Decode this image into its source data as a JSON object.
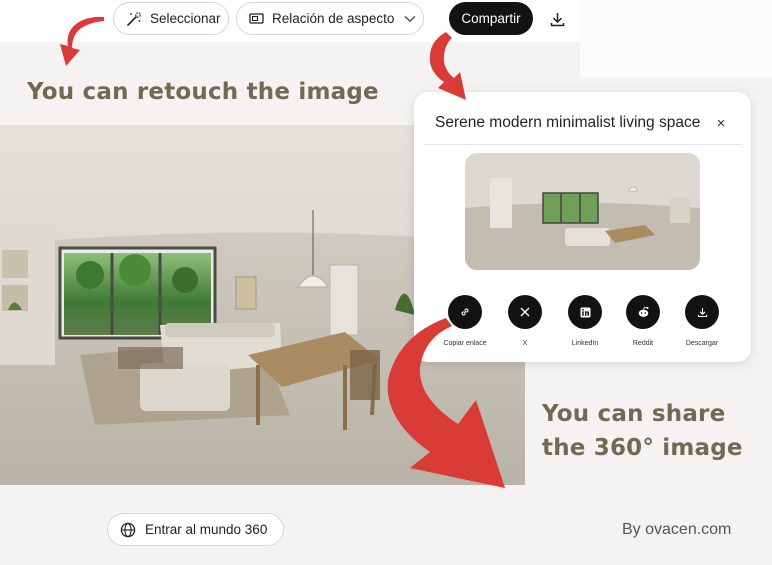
{
  "toolbar": {
    "select_label": "Seleccionar",
    "aspect_label": "Relación de aspecto",
    "share_label": "Compartir"
  },
  "captions": {
    "retouch": "You can retouch the image",
    "share_line1": "You can share",
    "share_line2": "the 360° image",
    "credit": "By ovacen.com"
  },
  "modal": {
    "title": "Serene modern minimalist living space",
    "close": "×",
    "share_options": [
      {
        "label": "Copiar enlace",
        "icon": "link-icon"
      },
      {
        "label": "X",
        "icon": "x-icon"
      },
      {
        "label": "LinkedIn",
        "icon": "linkedin-icon"
      },
      {
        "label": "Reddit",
        "icon": "reddit-icon"
      },
      {
        "label": "Descargar",
        "icon": "download-icon"
      }
    ]
  },
  "bottom": {
    "world_label": "Entrar al mundo 360"
  },
  "colors": {
    "caption": "#6f6a52",
    "arrow": "#d93b36",
    "dark_button": "#121212"
  }
}
